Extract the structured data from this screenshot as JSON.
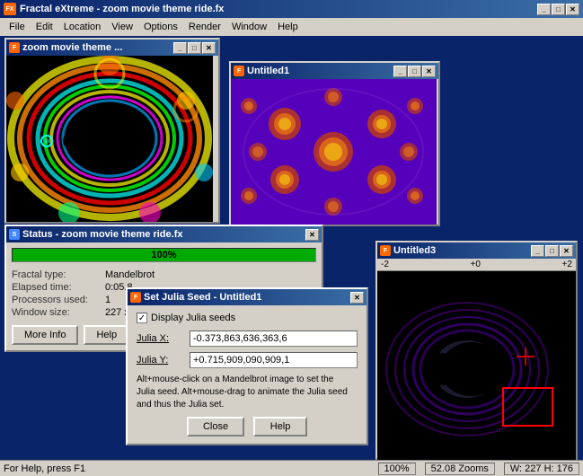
{
  "main_window": {
    "title": "Fractal eXtreme - zoom movie theme ride.fx",
    "icon": "FX"
  },
  "menu": {
    "items": [
      "File",
      "Edit",
      "Location",
      "View",
      "Options",
      "Render",
      "Window",
      "Help"
    ]
  },
  "fractal_window1": {
    "title": "zoom movie theme ...",
    "fractal_type": "mandelbrot"
  },
  "fractal_window2": {
    "title": "Untitled1",
    "fractal_type": "julia"
  },
  "fractal_window3": {
    "title": "Untitled3",
    "fractal_type": "mandelbrot3",
    "coords": {
      "left": "-2",
      "mid": "+0",
      "right": "+2"
    }
  },
  "status_window": {
    "title": "Status - zoom movie theme ride.fx",
    "progress": 100,
    "progress_label": "100%",
    "fields": {
      "fractal_type_label": "Fractal type:",
      "fractal_type_value": "Mandelbrot",
      "elapsed_label": "Elapsed time:",
      "elapsed_value": "0:05.8",
      "processors_label": "Processors used:",
      "processors_value": "1",
      "window_size_label": "Window size:",
      "window_size_value": "227 x 1..."
    },
    "buttons": {
      "more_info": "More Info",
      "help": "Help"
    }
  },
  "julia_dialog": {
    "title": "Set Julia Seed - Untitled1",
    "checkbox_label": "Display Julia seeds",
    "checkbox_checked": true,
    "julia_x_label": "Julia X:",
    "julia_x_value": "-0.373,863,636,363,6",
    "julia_y_label": "Julia Y:",
    "julia_y_value": "+0.715,909,090,909,1",
    "info_text": "Alt+mouse-click on a Mandelbrot image to set the\nJulia seed. Alt+mouse-drag to animate the Julia seed\nand thus the Julia set.",
    "buttons": {
      "close": "Close",
      "help": "Help"
    }
  },
  "bottom_status": {
    "help_text": "For Help, press F1",
    "zoom": "100%",
    "zooms": "52.08 Zooms",
    "dimensions": "W: 227 H: 176"
  }
}
